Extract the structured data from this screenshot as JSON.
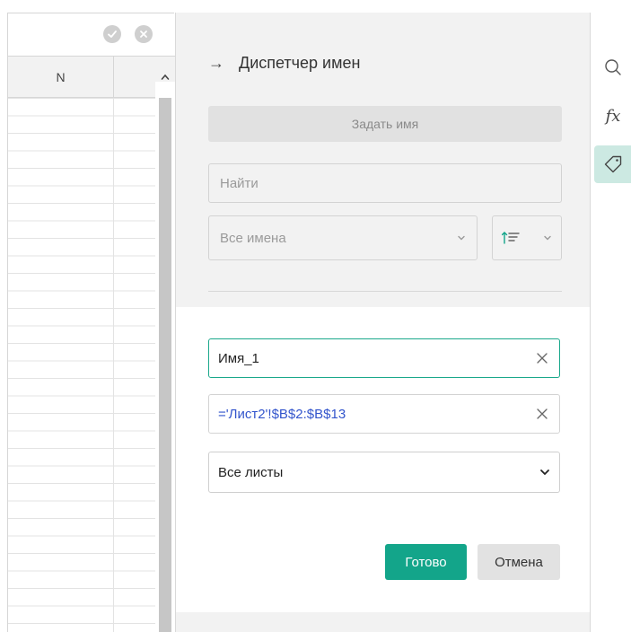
{
  "spreadsheet": {
    "column_header": "N"
  },
  "panel": {
    "title": "Диспетчер имен",
    "define_name_label": "Задать имя",
    "search_placeholder": "Найти",
    "filter_value": "Все имена",
    "edit": {
      "name_value": "Имя_1",
      "formula_value": "='Лист2'!$B$2:$B$13",
      "scope_value": "Все листы",
      "done_label": "Готово",
      "cancel_label": "Отмена"
    }
  },
  "toolstrip": {
    "icons": [
      "search-icon",
      "function-fx-icon",
      "tag-icon"
    ],
    "active": "tag-icon"
  },
  "colors": {
    "accent": "#13a58a",
    "active_field_border": "#1aa88b",
    "formula_text": "#3355cc",
    "panel_bg": "#f2f2f2"
  }
}
